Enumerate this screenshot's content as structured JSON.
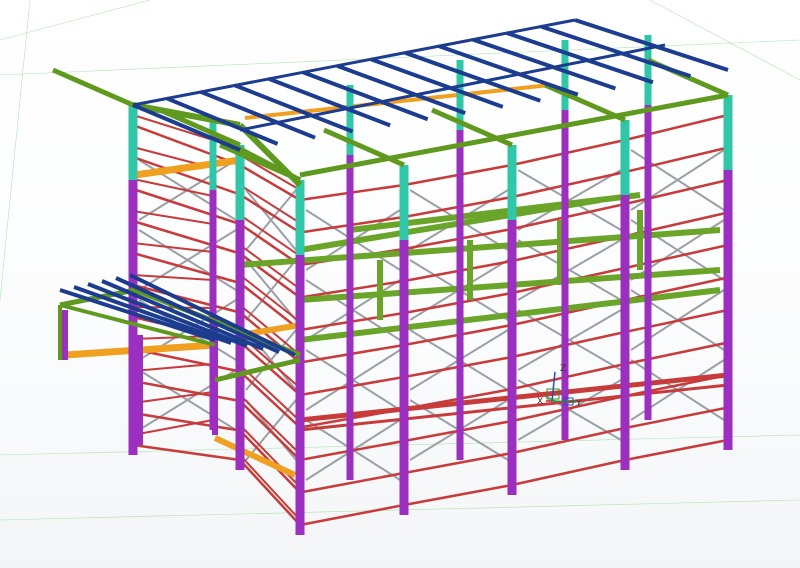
{
  "viewport": {
    "background": "#ffffff",
    "grid_color": "#7fd37f"
  },
  "model": {
    "colors": {
      "column": "#9b2fbf",
      "column_top": "#2fc7a7",
      "rafter": "#5f9a1f",
      "purlin": "#1c3c8f",
      "girt": "#c83b3b",
      "brace": "#9aa0a6",
      "crane_beam": "#f0a020",
      "floor_beam": "#6aa52a"
    }
  },
  "coordinate_system": {
    "z_label": "Z",
    "x_label": "X",
    "y_label": "Y"
  }
}
